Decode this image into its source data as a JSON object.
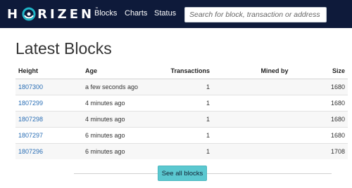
{
  "brand": {
    "logo_left": "H",
    "logo_right": "RIZEN",
    "trademark": "™"
  },
  "nav": {
    "blocks": "Blocks",
    "charts": "Charts",
    "status": "Status"
  },
  "search": {
    "placeholder": "Search for block, transaction or address"
  },
  "page": {
    "title": "Latest Blocks"
  },
  "table": {
    "headers": {
      "height": "Height",
      "age": "Age",
      "transactions": "Transactions",
      "mined_by": "Mined by",
      "size": "Size"
    },
    "rows": [
      {
        "height": "1807300",
        "age": "a few seconds ago",
        "transactions": "1",
        "mined_by": "",
        "size": "1680"
      },
      {
        "height": "1807299",
        "age": "4 minutes ago",
        "transactions": "1",
        "mined_by": "",
        "size": "1680"
      },
      {
        "height": "1807298",
        "age": "4 minutes ago",
        "transactions": "1",
        "mined_by": "",
        "size": "1680"
      },
      {
        "height": "1807297",
        "age": "6 minutes ago",
        "transactions": "1",
        "mined_by": "",
        "size": "1680"
      },
      {
        "height": "1807296",
        "age": "6 minutes ago",
        "transactions": "1",
        "mined_by": "",
        "size": "1708"
      }
    ]
  },
  "footer": {
    "see_all": "See all blocks"
  },
  "colors": {
    "navbar": "#0e1a3a",
    "link": "#2a6eb5",
    "button": "#5bc8d0",
    "logo_ring": "#1fb6c8"
  }
}
